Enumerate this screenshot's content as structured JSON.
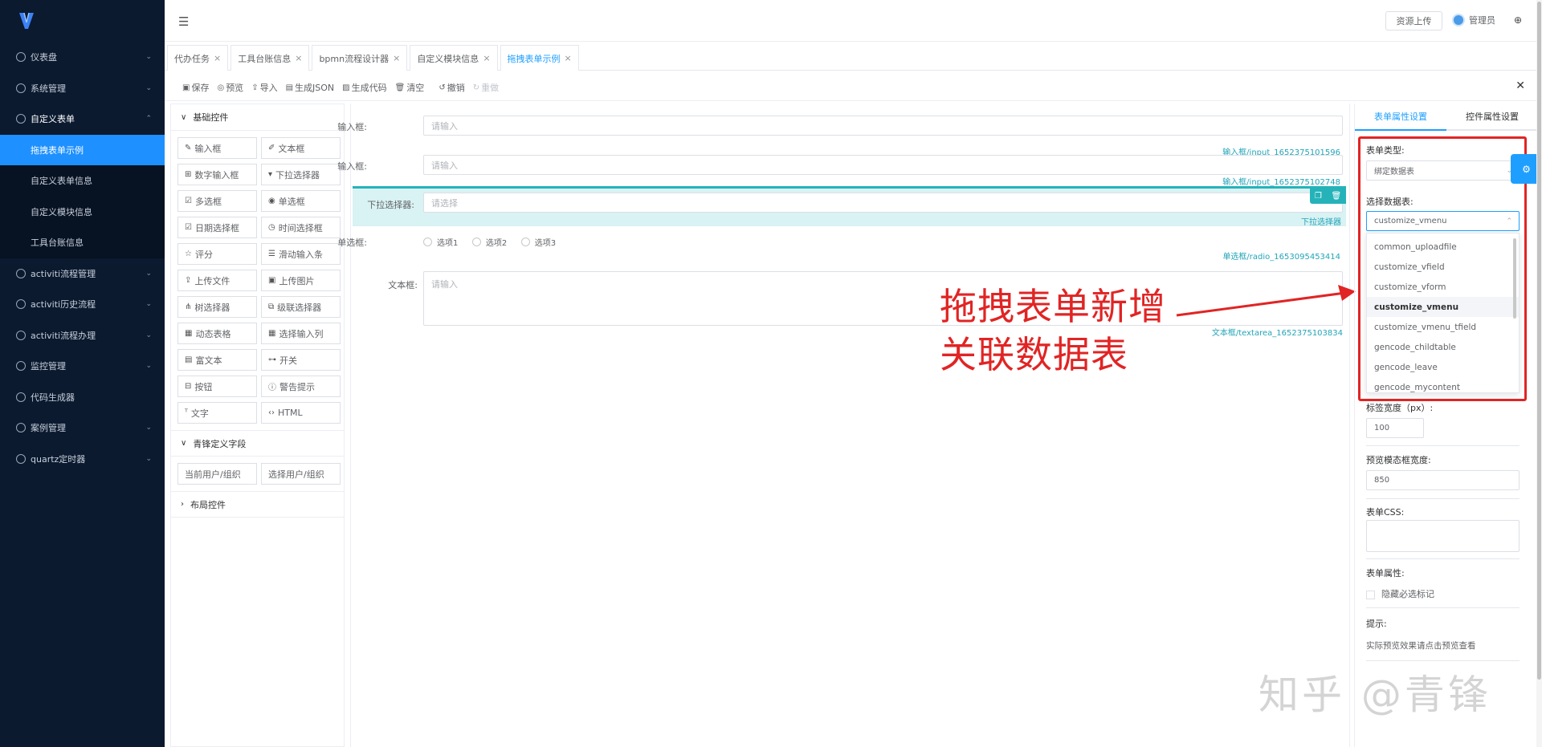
{
  "sidebar": {
    "items": [
      {
        "label": "仪表盘"
      },
      {
        "label": "系统管理"
      },
      {
        "label": "自定义表单"
      },
      {
        "label": "activiti流程管理"
      },
      {
        "label": "activiti历史流程"
      },
      {
        "label": "activiti流程办理"
      },
      {
        "label": "监控管理"
      },
      {
        "label": "代码生成器"
      },
      {
        "label": "案例管理"
      },
      {
        "label": "quartz定时器"
      }
    ],
    "subitems": [
      {
        "label": "拖拽表单示例"
      },
      {
        "label": "自定义表单信息"
      },
      {
        "label": "自定义模块信息"
      },
      {
        "label": "工具台账信息"
      }
    ]
  },
  "header": {
    "upload_label": "资源上传",
    "user_name": "管理员"
  },
  "tabs": [
    {
      "label": "代办任务"
    },
    {
      "label": "工具台账信息"
    },
    {
      "label": "bpmn流程设计器"
    },
    {
      "label": "自定义模块信息"
    },
    {
      "label": "拖拽表单示例"
    }
  ],
  "toolbar": {
    "save": "保存",
    "preview": "预览",
    "import": "导入",
    "gen_json": "生成JSON",
    "gen_code": "生成代码",
    "clear": "清空",
    "undo": "撤销",
    "redo": "重做"
  },
  "left_panel": {
    "basic_group": "基础控件",
    "widgets": [
      {
        "label": "输入框",
        "icon": "✎"
      },
      {
        "label": "文本框",
        "icon": "✐"
      },
      {
        "label": "数字输入框",
        "icon": "⊞"
      },
      {
        "label": "下拉选择器",
        "icon": "▾"
      },
      {
        "label": "多选框",
        "icon": "☑"
      },
      {
        "label": "单选框",
        "icon": "◉"
      },
      {
        "label": "日期选择框",
        "icon": "☑"
      },
      {
        "label": "时间选择框",
        "icon": "◷"
      },
      {
        "label": "评分",
        "icon": "☆"
      },
      {
        "label": "滑动输入条",
        "icon": "☰"
      },
      {
        "label": "上传文件",
        "icon": "⇪"
      },
      {
        "label": "上传图片",
        "icon": "▣"
      },
      {
        "label": "树选择器",
        "icon": "⋔"
      },
      {
        "label": "级联选择器",
        "icon": "⧉"
      },
      {
        "label": "动态表格",
        "icon": "▦"
      },
      {
        "label": "选择输入列",
        "icon": "▦"
      },
      {
        "label": "富文本",
        "icon": "▤"
      },
      {
        "label": "开关",
        "icon": "⊶"
      },
      {
        "label": "按钮",
        "icon": "⊟"
      },
      {
        "label": "警告提示",
        "icon": "ⓘ"
      },
      {
        "label": "文字",
        "icon": "ᵀ"
      },
      {
        "label": "HTML",
        "icon": "‹›"
      }
    ],
    "custom_group": "青锋定义字段",
    "custom_widgets": [
      {
        "label": "当前用户/组织"
      },
      {
        "label": "选择用户/组织"
      }
    ],
    "layout_group": "布局控件"
  },
  "canvas": {
    "fields": [
      {
        "label": "输入框:",
        "placeholder": "请输入",
        "hint": "输入框/input_1652375101596"
      },
      {
        "label": "输入框:",
        "placeholder": "请输入",
        "hint": "输入框/input_1652375102748"
      },
      {
        "label": "下拉选择器:",
        "placeholder": "请选择",
        "hint": "下拉选择器"
      },
      {
        "label": "单选框:",
        "hint": "单选框/radio_1653095453414",
        "options": [
          "选项1",
          "选项2",
          "选项3"
        ]
      },
      {
        "label": "文本框:",
        "placeholder": "请输入",
        "hint": "文本框/textarea_1652375103834"
      }
    ],
    "annotation_line1": "拖拽表单新增",
    "annotation_line2": "关联数据表",
    "watermark": "知乎 @青锋"
  },
  "right_panel": {
    "tab_form": "表单属性设置",
    "tab_widget": "控件属性设置",
    "form_type_label": "表单类型:",
    "form_type_value": "绑定数据表",
    "table_label": "选择数据表:",
    "table_value": "customize_vmenu",
    "table_options": [
      "common_uploadfile",
      "customize_vfield",
      "customize_vform",
      "customize_vmenu",
      "customize_vmenu_tfield",
      "gencode_childtable",
      "gencode_leave",
      "gencode_mycontent"
    ],
    "selected_option": "customize_vmenu",
    "label_width_label": "标签宽度（px）:",
    "label_width_value": "100",
    "preview_width_label": "预览模态框宽度:",
    "preview_width_value": "850",
    "css_label": "表单CSS:",
    "props_label": "表单属性:",
    "hide_required_label": "隐藏必选标记",
    "tip_label": "提示:",
    "tip_text": "实际预览效果请点击预览查看"
  }
}
